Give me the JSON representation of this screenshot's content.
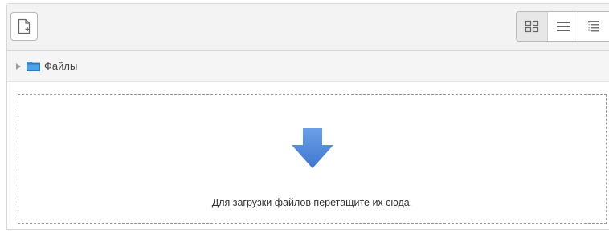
{
  "filemanager": {
    "path": {
      "folder_label": "Файлы"
    },
    "dropzone": {
      "instruction": "Для загрузки файлов перетащите их сюда."
    },
    "icons": {
      "add_file": "add-file-icon",
      "view_icons": "grid-view-icon",
      "view_list": "list-view-icon",
      "view_tree": "tree-view-icon",
      "folder": "folder-icon",
      "expand": "expand-arrow-icon",
      "drop": "download-arrow-icon"
    },
    "colors": {
      "toolbar_bg": "#f3f3f3",
      "folder": "#3a8fd8",
      "drop_arrow": "#4a86d8"
    }
  }
}
